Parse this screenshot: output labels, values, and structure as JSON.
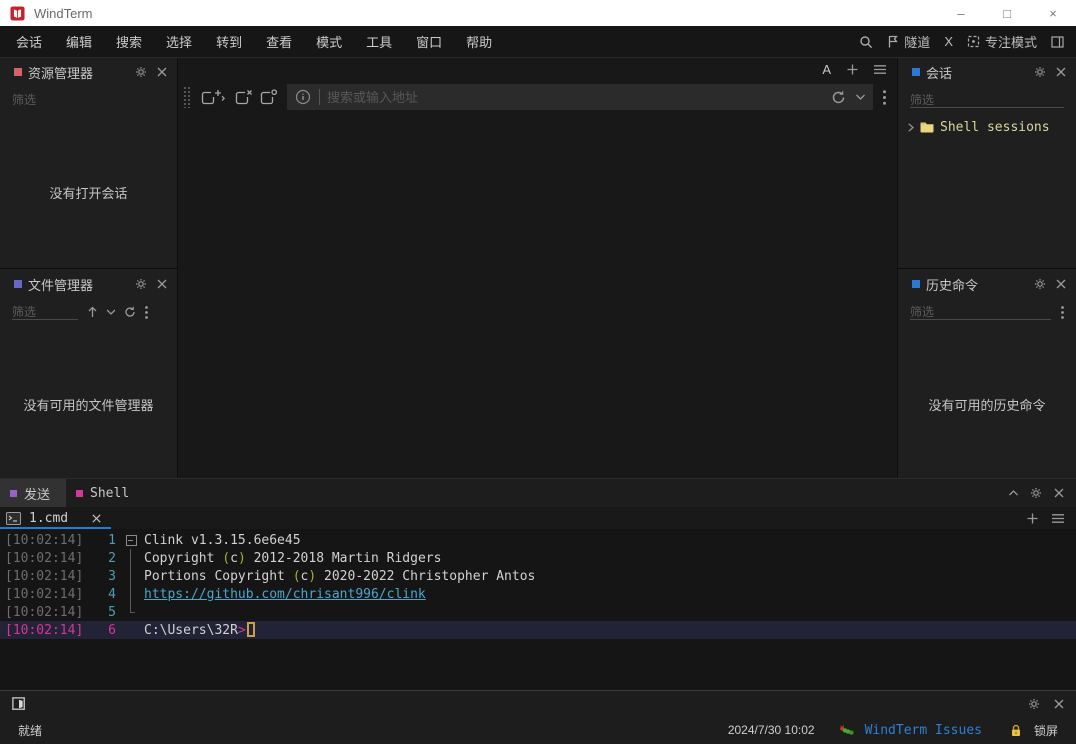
{
  "window": {
    "title": "WindTerm",
    "controls": {
      "minimize": "–",
      "maximize": "□",
      "close": "×"
    }
  },
  "menu": {
    "items": [
      "会话",
      "编辑",
      "搜索",
      "选择",
      "转到",
      "查看",
      "模式",
      "工具",
      "窗口",
      "帮助"
    ],
    "tunnel_label": "隧道",
    "x_server_label": "X",
    "focus_mode_label": "专注模式"
  },
  "explorer_panel": {
    "title": "资源管理器",
    "filter_placeholder": "筛选",
    "empty_text": "没有打开会话",
    "accent": "#d4646a"
  },
  "file_panel": {
    "title": "文件管理器",
    "filter_placeholder": "筛选",
    "empty_text": "没有可用的文件管理器",
    "accent": "#6767c9"
  },
  "session_panel": {
    "title": "会话",
    "filter_placeholder": "筛选",
    "tree_item_label": "Shell sessions",
    "accent": "#2a7ad4"
  },
  "history_panel": {
    "title": "历史命令",
    "filter_placeholder": "筛选",
    "empty_text": "没有可用的历史命令",
    "accent": "#2a7ad4"
  },
  "address_bar": {
    "placeholder": "搜索或输入地址",
    "font_badge": "A"
  },
  "bottom_panel": {
    "dock_tabs": [
      {
        "label": "发送",
        "color": "#9a5fd0",
        "active": true
      },
      {
        "label": "Shell",
        "color": "#d6369b",
        "active": false
      }
    ],
    "file_tab": {
      "label": "1.cmd"
    },
    "terminal": {
      "lines": [
        {
          "timestamp": "[10:02:14]",
          "number": "1",
          "fold": "start",
          "current": false,
          "segments": [
            {
              "text": "Clink v1.3.15.6e6e45",
              "style": "fg"
            }
          ]
        },
        {
          "timestamp": "[10:02:14]",
          "number": "2",
          "fold": "mid",
          "current": false,
          "segments": [
            {
              "text": "Copyright ",
              "style": "fg"
            },
            {
              "text": "(",
              "style": "green"
            },
            {
              "text": "c",
              "style": "fg"
            },
            {
              "text": ")",
              "style": "green"
            },
            {
              "text": " 2012-2018 Martin Ridgers",
              "style": "fg"
            }
          ]
        },
        {
          "timestamp": "[10:02:14]",
          "number": "3",
          "fold": "mid",
          "current": false,
          "segments": [
            {
              "text": "Portions Copyright ",
              "style": "fg"
            },
            {
              "text": "(",
              "style": "green"
            },
            {
              "text": "c",
              "style": "fg"
            },
            {
              "text": ")",
              "style": "green"
            },
            {
              "text": " 2020-2022 Christopher Antos",
              "style": "fg"
            }
          ]
        },
        {
          "timestamp": "[10:02:14]",
          "number": "4",
          "fold": "mid",
          "current": false,
          "segments": [
            {
              "text": "https://github.com/chrisant996/clink",
              "style": "link"
            }
          ]
        },
        {
          "timestamp": "[10:02:14]",
          "number": "5",
          "fold": "end",
          "current": false,
          "segments": []
        },
        {
          "timestamp": "[10:02:14]",
          "number": "6",
          "fold": "none",
          "current": true,
          "segments": [
            {
              "text": "C:\\Users\\32R",
              "style": "fg"
            },
            {
              "text": ">",
              "style": "magenta"
            },
            {
              "text": "",
              "style": "cursor"
            }
          ]
        }
      ]
    }
  },
  "status_bar": {
    "ready_text": "就绪",
    "datetime": "2024/7/30 10:02",
    "issues_label": "WindTerm Issues",
    "lock_label": "锁屏"
  },
  "colors": {
    "accent_blue": "#1d7fd4",
    "link": "#4aa7cc",
    "magenta": "#d6369b",
    "line_number_cyan": "#4f9db0",
    "cursor_amber": "#cf9f45",
    "brand_red": "#c4232b",
    "issues_blue": "#2f7fd6"
  }
}
